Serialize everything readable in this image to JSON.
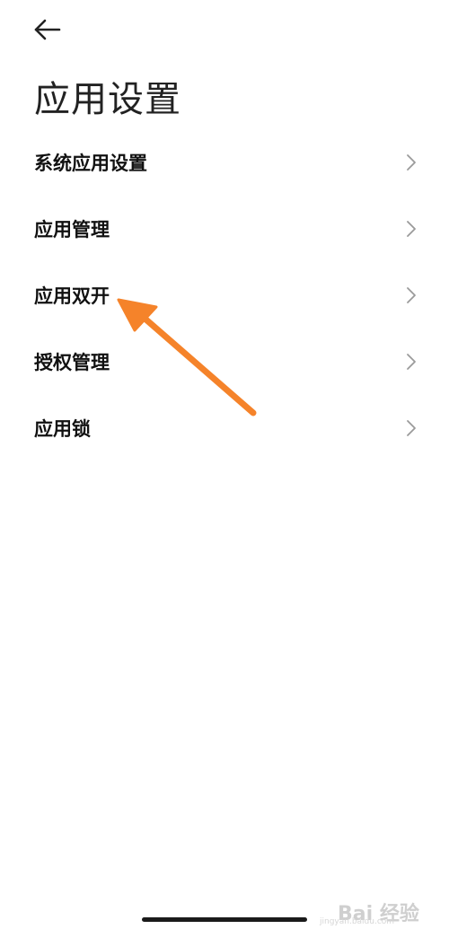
{
  "header": {
    "back_icon": "arrow-left-icon",
    "title": "应用设置"
  },
  "menu": {
    "items": [
      {
        "label": "系统应用设置",
        "icon": "chevron-right-icon"
      },
      {
        "label": "应用管理",
        "icon": "chevron-right-icon"
      },
      {
        "label": "应用双开",
        "icon": "chevron-right-icon"
      },
      {
        "label": "授权管理",
        "icon": "chevron-right-icon"
      },
      {
        "label": "应用锁",
        "icon": "chevron-right-icon"
      }
    ]
  },
  "annotation": {
    "type": "arrow",
    "color": "#F5832A",
    "points_to": "应用双开"
  },
  "watermark": {
    "brand": "Bai 经验",
    "url": "jingyan.baidu.com"
  },
  "colors": {
    "background": "#ffffff",
    "text": "#111111",
    "chevron": "#9a9a9a",
    "annotation_arrow": "#F5832A"
  }
}
